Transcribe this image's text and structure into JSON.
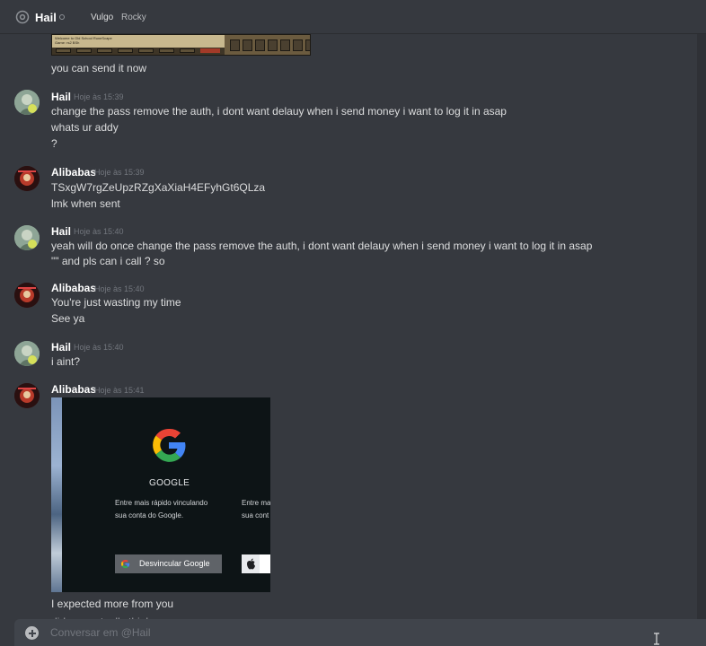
{
  "header": {
    "title": "Hail",
    "links": [
      "Vulgo",
      "Rocky"
    ]
  },
  "top_embed": {
    "caption_lines": [
      "Welcome to Old School RuneScape",
      "Game: rs2 BSh"
    ]
  },
  "top_message": "you can send it now",
  "messages": [
    {
      "author": "Hail",
      "time": "Hoje às 15:39",
      "lines": [
        "change the pass remove the auth, i dont want delauy when i send money i want to log it in asap",
        "whats ur addy",
        "?"
      ]
    },
    {
      "author": "Alibabas",
      "time": "Hoje às 15:39",
      "lines": [
        "TSxgW7rgZeUpzRZgXaXiaH4EFyhGt6QLza",
        "lmk when sent"
      ]
    },
    {
      "author": "Hail",
      "time": "Hoje às 15:40",
      "lines": [
        "yeah will do once change the pass remove the auth, i dont want delauy when i send money i want to log it in asap",
        "\"\" and pls can i call ? so"
      ]
    },
    {
      "author": "Alibabas",
      "time": "Hoje às 15:40",
      "lines": [
        "You're just wasting my time",
        "See ya"
      ]
    },
    {
      "author": "Hail",
      "time": "Hoje às 15:40",
      "lines": [
        "i aint?"
      ]
    },
    {
      "author": "Alibabas",
      "time": "Hoje às 15:41",
      "lines": [
        "I expected more from you",
        "did you actually think"
      ]
    }
  ],
  "google_card": {
    "title": "GOOGLE",
    "desc_line1": "Entre mais rápido vinculando",
    "desc_line2": "sua conta do Google.",
    "desc_cut1": "Entre ma",
    "desc_cut2": "sua cont",
    "button_label": "Desvincular Google"
  },
  "composer": {
    "placeholder": "Conversar em @Hail"
  },
  "colors": {
    "background": "#36393f",
    "composer": "#40444b",
    "text": "#dcddde",
    "muted": "#72767d"
  },
  "icons": [
    "at-icon",
    "status-icon",
    "google-logo-icon",
    "google-g-icon",
    "apple-icon",
    "plus-icon",
    "text-cursor-icon"
  ]
}
